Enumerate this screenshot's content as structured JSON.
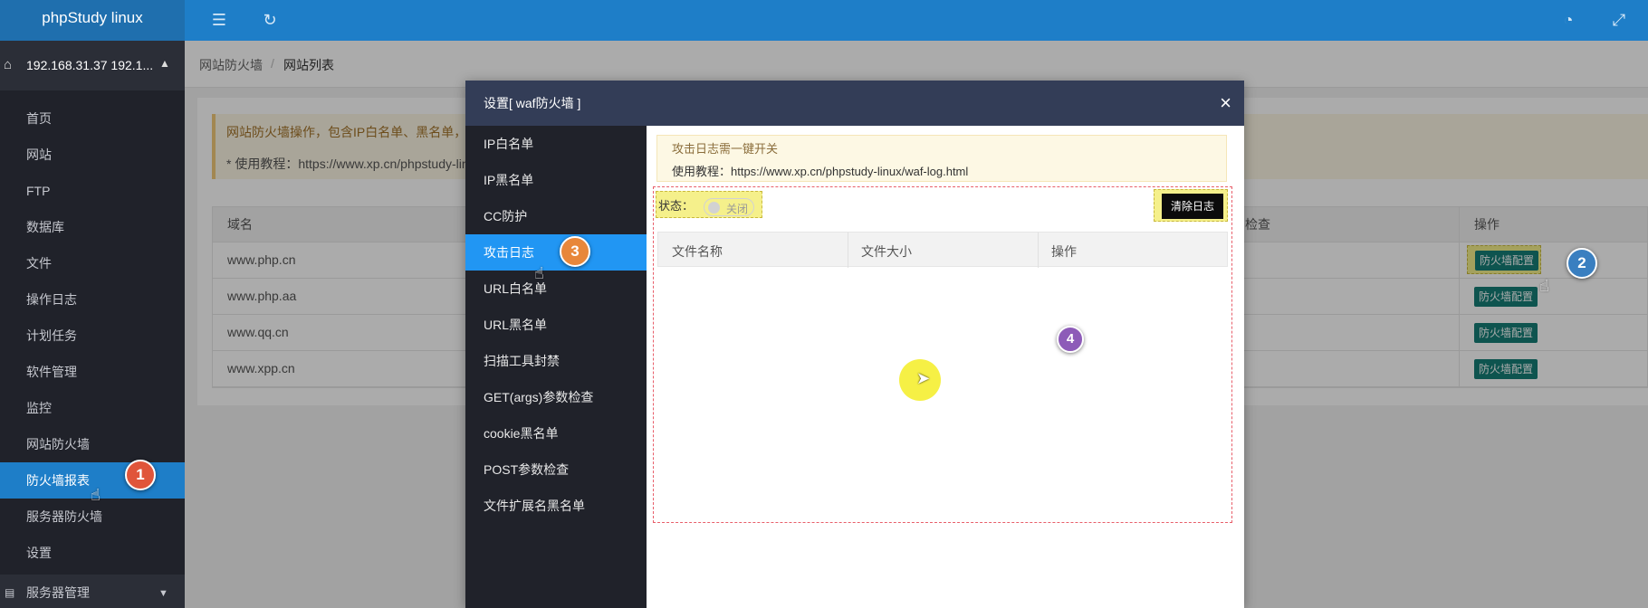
{
  "topbar": {
    "brand": "phpStudy linux",
    "icons": [
      "menu-fold-icon",
      "refresh-icon",
      "palette-icon",
      "fullscreen-icon"
    ]
  },
  "sidebar": {
    "server": "192.168.31.37 192.1...",
    "items": [
      {
        "label": "首页"
      },
      {
        "label": "网站"
      },
      {
        "label": "FTP"
      },
      {
        "label": "数据库"
      },
      {
        "label": "文件"
      },
      {
        "label": "操作日志"
      },
      {
        "label": "计划任务"
      },
      {
        "label": "软件管理"
      },
      {
        "label": "监控"
      },
      {
        "label": "网站防火墙"
      },
      {
        "label": "防火墙报表",
        "active": true
      },
      {
        "label": "服务器防火墙"
      },
      {
        "label": "设置"
      }
    ],
    "group": "服务器管理"
  },
  "breadcrumb": {
    "parent": "网站防火墙",
    "separator": "/",
    "current": "网站列表"
  },
  "notice": {
    "line1": "网站防火墙操作，包含IP白名单、黑名单，",
    "line2": "* 使用教程：https://www.xp.cn/phpstudy-lin"
  },
  "table": {
    "headers": {
      "domain": "域名",
      "check": "检查",
      "ops": "操作"
    },
    "rows": [
      {
        "domain": "www.php.cn",
        "button": "防火墙配置"
      },
      {
        "domain": "www.php.aa",
        "button": "防火墙配置"
      },
      {
        "domain": "www.qq.cn",
        "button": "防火墙配置"
      },
      {
        "domain": "www.xpp.cn",
        "button": "防火墙配置"
      }
    ]
  },
  "modal": {
    "title": "设置[ waf防火墙 ]",
    "close": "×",
    "menu": [
      {
        "label": "IP白名单"
      },
      {
        "label": "IP黑名单"
      },
      {
        "label": "CC防护"
      },
      {
        "label": "攻击日志",
        "active": true
      },
      {
        "label": "URL白名单"
      },
      {
        "label": "URL黑名单"
      },
      {
        "label": "扫描工具封禁"
      },
      {
        "label": "GET(args)参数检查"
      },
      {
        "label": "cookie黑名单"
      },
      {
        "label": "POST参数检查"
      },
      {
        "label": "文件扩展名黑名单"
      }
    ],
    "warn_line1": "攻击日志需一键开关",
    "warn_line2": "使用教程：https://www.xp.cn/phpstudy-linux/waf-log.html",
    "status_label": "状态：",
    "toggle_text": "关闭",
    "toggle_on": false,
    "clear_button": "清除日志",
    "log_table": {
      "headers": [
        "文件名称",
        "文件大小",
        "操作"
      ]
    }
  },
  "annotations": {
    "badges": [
      {
        "label": "1",
        "color": "#e0553a"
      },
      {
        "label": "2",
        "color": "#3a7fc0"
      },
      {
        "label": "3",
        "color": "#e8873a"
      },
      {
        "label": "4",
        "color": "#8d5bb8"
      }
    ],
    "highlight_color": "#f5f08b"
  }
}
